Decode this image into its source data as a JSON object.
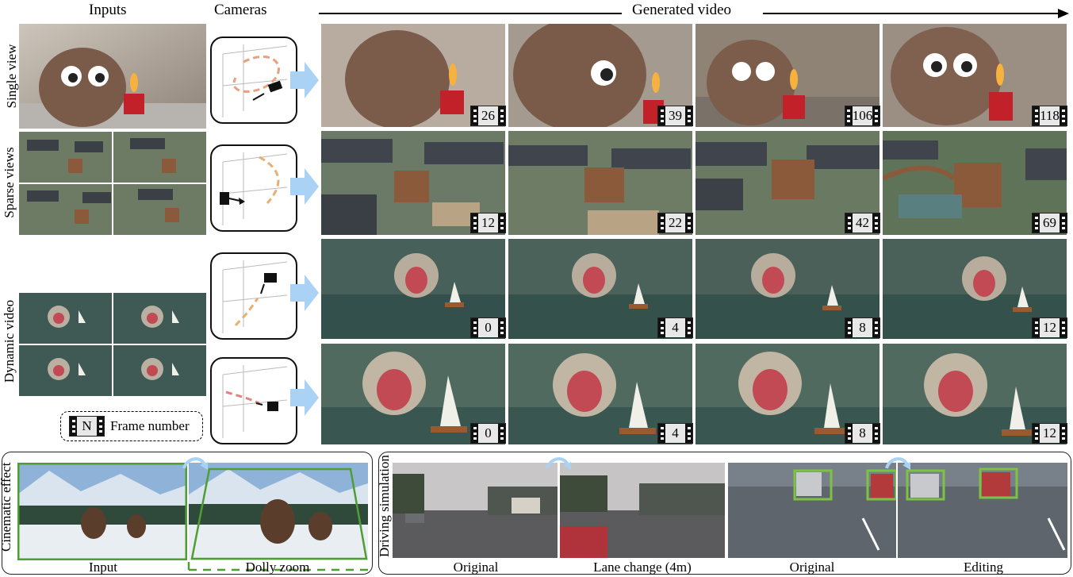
{
  "headers": {
    "inputs": "Inputs",
    "cameras": "Cameras",
    "generated": "Generated video"
  },
  "row_labels": {
    "single": "Single view",
    "sparse": "Sparse views",
    "dynamic": "Dynamic video",
    "cinematic": "Cinematic effect",
    "driving": "Driving simulation"
  },
  "frames": {
    "row1": [
      "26",
      "39",
      "106",
      "118"
    ],
    "row2": [
      "12",
      "22",
      "42",
      "69"
    ],
    "row3": [
      "0",
      "4",
      "8",
      "12"
    ],
    "row4": [
      "0",
      "4",
      "8",
      "12"
    ]
  },
  "legend": {
    "symbol": "N",
    "label": "Frame number"
  },
  "captions": {
    "input": "Input",
    "dolly": "Dolly zoom",
    "original1": "Original",
    "lane": "Lane change (4m)",
    "original2": "Original",
    "editing": "Editing"
  },
  "colors": {
    "accent_arrow": "#a9d2f5",
    "box_green": "#7dc242",
    "frame_green": "#4f9e33"
  }
}
